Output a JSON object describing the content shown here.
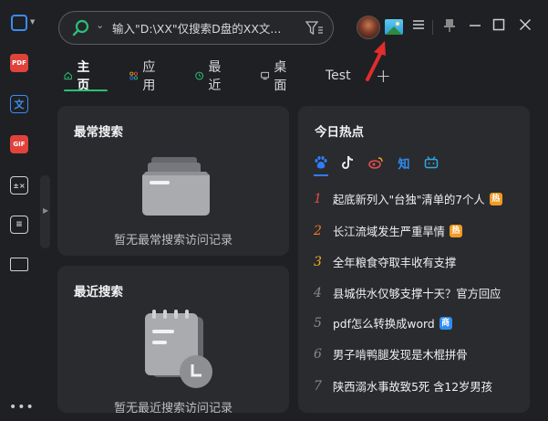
{
  "search": {
    "placeholder": "输入\"D:\\XX\"仅搜索D盘的XX文..."
  },
  "titlebar": {
    "menu_icon": "hamburger-icon",
    "pin_icon": "pin-icon",
    "minimize_icon": "minimize-icon",
    "maximize_icon": "maximize-icon",
    "close_icon": "close-icon"
  },
  "sidebar": {
    "items": [
      {
        "icon": "screenshot-icon"
      },
      {
        "icon": "pdf-icon",
        "label": "PDF"
      },
      {
        "icon": "translate-icon"
      },
      {
        "icon": "gif-icon",
        "label": "GIF"
      },
      {
        "icon": "calculator-icon"
      },
      {
        "icon": "notes-icon"
      },
      {
        "icon": "desktop-icon"
      }
    ],
    "more": "•••"
  },
  "tabs": [
    {
      "label": "主页",
      "icon": "home-icon"
    },
    {
      "label": "应用",
      "icon": "apps-icon"
    },
    {
      "label": "最近",
      "icon": "clock-icon"
    },
    {
      "label": "桌面",
      "icon": "monitor-icon"
    },
    {
      "label": "Test"
    },
    {
      "label": "+"
    }
  ],
  "frequent": {
    "title": "最常搜索",
    "empty": "暂无最常搜索访问记录"
  },
  "recent": {
    "title": "最近搜索",
    "empty": "暂无最近搜索访问记录"
  },
  "hot": {
    "title": "今日热点",
    "sources": [
      "baidu-icon",
      "douyin-icon",
      "weibo-icon",
      "zhihu-icon",
      "bilibili-icon"
    ],
    "items": [
      {
        "rank": "1",
        "text": "起底新列入\"台独\"清单的7个人",
        "badge": "热"
      },
      {
        "rank": "2",
        "text": "长江流域发生严重旱情",
        "badge": "热"
      },
      {
        "rank": "3",
        "text": "全年粮食夺取丰收有支撑",
        "badge": ""
      },
      {
        "rank": "4",
        "text": "县城供水仅够支撑十天？官方回应",
        "badge": ""
      },
      {
        "rank": "5",
        "text": "pdf怎么转换成word",
        "badge": "商"
      },
      {
        "rank": "6",
        "text": "男子啃鸭腿发现是木棍拼骨",
        "badge": ""
      },
      {
        "rank": "7",
        "text": "陕西溺水事故致5死 含12岁男孩",
        "badge": ""
      }
    ]
  },
  "colors": {
    "accent_green": "#2bbf77",
    "accent_blue": "#2f7cf6",
    "rank1": "#e24d4d",
    "rank2": "#f07a2a",
    "rank3": "#f0b020"
  }
}
